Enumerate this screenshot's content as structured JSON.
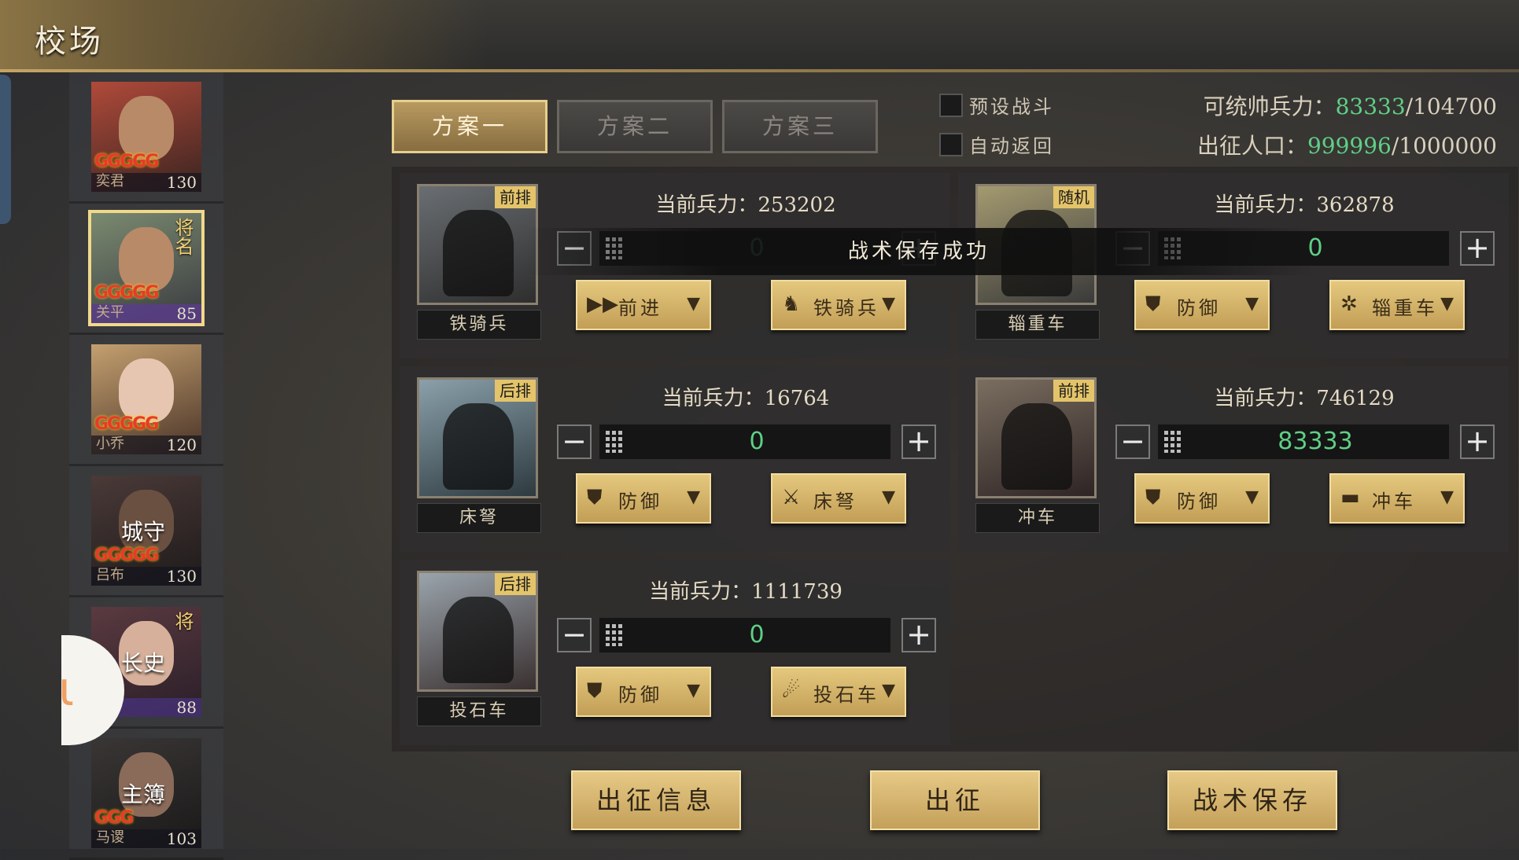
{
  "header": {
    "title": "校场"
  },
  "heroes": [
    {
      "name": "奕君",
      "level": "130",
      "stars": "GGGGG",
      "role": "",
      "badge": "",
      "selected": false
    },
    {
      "name": "关平",
      "level": "85",
      "stars": "GGGGG",
      "role": "",
      "badge": "将名",
      "selected": true
    },
    {
      "name": "小乔",
      "level": "120",
      "stars": "GGGGG",
      "role": "",
      "badge": "",
      "selected": false
    },
    {
      "name": "吕布",
      "level": "130",
      "stars": "GGGGG",
      "role": "城守",
      "badge": "",
      "selected": false
    },
    {
      "name": "",
      "level": "88",
      "stars": "",
      "role": "长史",
      "badge": "将",
      "selected": false
    },
    {
      "name": "马谡",
      "level": "103",
      "stars": "GGG",
      "role": "主簿",
      "badge": "",
      "selected": false
    }
  ],
  "tabs": [
    {
      "label": "方案一",
      "active": true
    },
    {
      "label": "方案二",
      "active": false
    },
    {
      "label": "方案三",
      "active": false
    }
  ],
  "options": {
    "preset_battle": "预设战斗",
    "auto_return": "自动返回"
  },
  "stats": {
    "command_label": "可统帅兵力：",
    "command_current": "83333",
    "command_max": "/104700",
    "population_label": "出征人口：",
    "population_current": "999996",
    "population_max": "/1000000"
  },
  "slots": [
    {
      "unit": "铁骑兵",
      "tag": "前排",
      "troops_label": "当前兵力：",
      "troops": "253202",
      "qty": "0",
      "tactic": "前进",
      "tactic_icon": "▶▶",
      "unit_type": "铁骑兵",
      "unit_type_icon": "♞"
    },
    {
      "unit": "辎重车",
      "tag": "随机",
      "troops_label": "当前兵力：",
      "troops": "362878",
      "qty": "0",
      "tactic": "防御",
      "tactic_icon": "⛊",
      "unit_type": "辎重车",
      "unit_type_icon": "✲"
    },
    {
      "unit": "床弩",
      "tag": "后排",
      "troops_label": "当前兵力：",
      "troops": "16764",
      "qty": "0",
      "tactic": "防御",
      "tactic_icon": "⛊",
      "unit_type": "床弩",
      "unit_type_icon": "⚔"
    },
    {
      "unit": "冲车",
      "tag": "前排",
      "troops_label": "当前兵力：",
      "troops": "746129",
      "qty": "83333",
      "tactic": "防御",
      "tactic_icon": "⛊",
      "unit_type": "冲车",
      "unit_type_icon": "▬"
    },
    {
      "unit": "投石车",
      "tag": "后排",
      "troops_label": "当前兵力：",
      "troops": "1111739",
      "qty": "0",
      "tactic": "防御",
      "tactic_icon": "⛊",
      "unit_type": "投石车",
      "unit_type_icon": "☄"
    }
  ],
  "toast": "战术保存成功",
  "buttons": {
    "info": "出征信息",
    "depart": "出征",
    "save": "战术保存"
  },
  "colors": {
    "accent_gold": "#e4c87d",
    "value_green": "#5fcf86"
  }
}
